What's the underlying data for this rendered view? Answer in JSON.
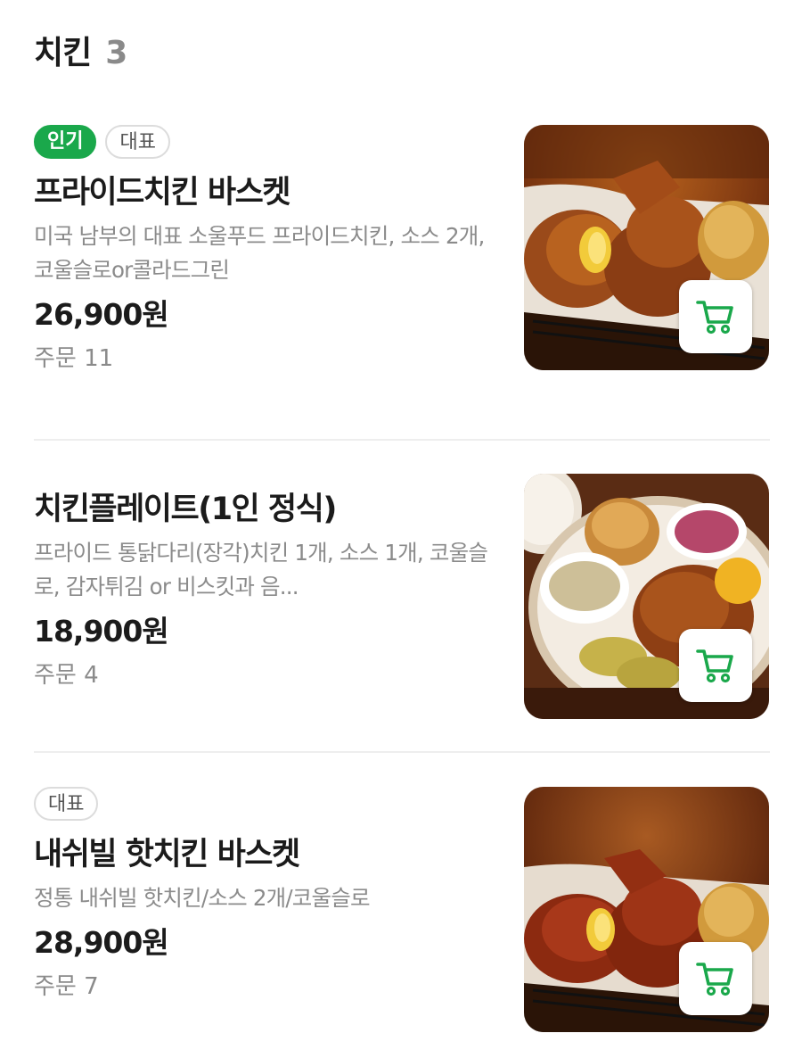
{
  "section": {
    "title": "치킨",
    "count": "3"
  },
  "items": [
    {
      "badges": [
        "인기",
        "대표"
      ],
      "name": "프라이드치킨 바스켓",
      "description": "미국 남부의 대표 소울푸드 프라이드치킨, 소스 2개, 코울슬로or콜라드그린",
      "price": "26,900원",
      "orders": "주문 11"
    },
    {
      "badges": [],
      "name": "치킨플레이트(1인 정식)",
      "description": "프라이드 통닭다리(장각)치킨 1개, 소스 1개, 코울슬로, 감자튀김 or 비스킷과 음...",
      "price": "18,900원",
      "orders": "주문 4"
    },
    {
      "badges": [
        "대표"
      ],
      "name": "내쉬빌 핫치킨 바스켓",
      "description": "정통 내쉬빌 핫치킨/소스 2개/코울슬로",
      "price": "28,900원",
      "orders": "주문 7"
    }
  ],
  "icons": {
    "cart": "shopping-cart-icon"
  },
  "colors": {
    "accent_green": "#1aa84b",
    "badge_border": "#dcdcdc",
    "muted_text": "#8b8b8b"
  }
}
